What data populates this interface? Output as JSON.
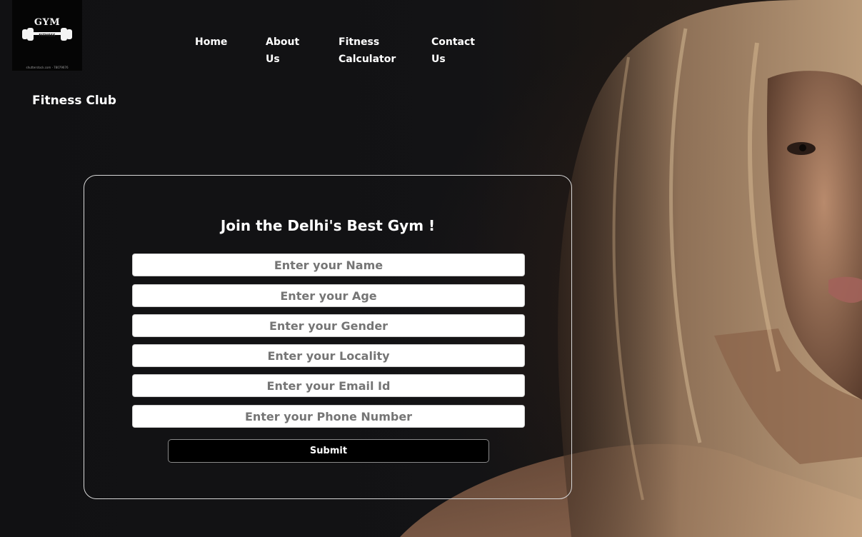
{
  "logo": {
    "title": "GYM",
    "subtitle": "FITNESS",
    "icon": "barbell-icon",
    "stock_text": "shutterstock.com · 78079676"
  },
  "nav": {
    "items": [
      {
        "label": "Home"
      },
      {
        "label": "About\nUs"
      },
      {
        "label": "Fitness\nCalculator"
      },
      {
        "label": "Contact\nUs"
      }
    ]
  },
  "brand": {
    "name": "Fitness Club"
  },
  "form": {
    "title": "Join the Delhi's Best Gym !",
    "fields": [
      {
        "placeholder": "Enter your Name"
      },
      {
        "placeholder": "Enter your Age"
      },
      {
        "placeholder": "Enter your Gender"
      },
      {
        "placeholder": "Enter your Locality"
      },
      {
        "placeholder": "Enter your Email Id"
      },
      {
        "placeholder": "Enter your Phone Number"
      }
    ],
    "submit_label": "Submit"
  },
  "colors": {
    "background": "#121214",
    "text": "#ffffff",
    "card_border": "#d8d8d8",
    "button_bg": "#000000"
  }
}
